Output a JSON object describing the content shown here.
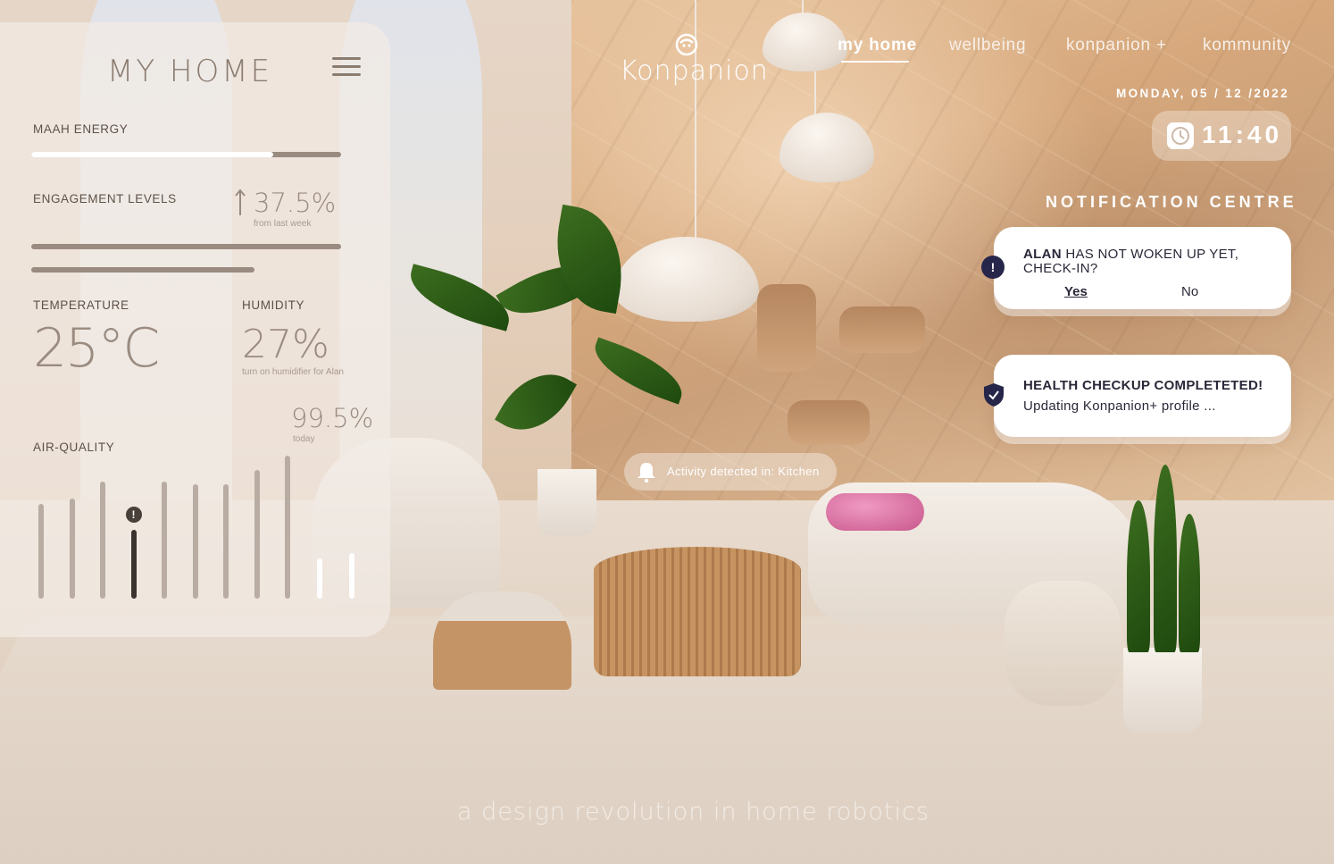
{
  "brand": {
    "name": "Konpanion"
  },
  "nav": {
    "items": [
      {
        "label": "my home",
        "active": true
      },
      {
        "label": "wellbeing",
        "active": false
      },
      {
        "label": "konpanion +",
        "active": false
      },
      {
        "label": "kommunity",
        "active": false
      }
    ]
  },
  "date": "MONDAY, 05 / 12 /2022",
  "clock": {
    "time": "11:40"
  },
  "panel": {
    "title": "MY HOME",
    "energy": {
      "label": "MAAH ENERGY",
      "level": 0.78
    },
    "engagement": {
      "label": "ENGAGEMENT LEVELS",
      "value": "37.5%",
      "note": "from last week",
      "bars": [
        1.0,
        0.72
      ]
    },
    "temperature": {
      "label": "TEMPERATURE",
      "value": "25°C"
    },
    "humidity": {
      "label": "HUMIDITY",
      "value": "27%",
      "note": "turn on humidifier for Alan"
    },
    "air_quality": {
      "label": "AIR-QUALITY",
      "value": "99.5%",
      "note": "today",
      "alert_index": 3,
      "bars": [
        0.66,
        0.7,
        0.82,
        0.48,
        0.82,
        0.8,
        0.8,
        0.9,
        1.0,
        0.28,
        0.32
      ]
    }
  },
  "notifications": {
    "title": "NOTIFICATION CENTRE",
    "items": [
      {
        "bold": "ALAN",
        "text": " HAS NOT WOKEN UP YET,",
        "text2": "CHECK-IN?",
        "yes": "Yes",
        "no": "No"
      },
      {
        "title": "HEALTH CHECKUP COMPLETETED!",
        "text": "Updating Konpanion+ profile ..."
      }
    ]
  },
  "activity": {
    "text": "Activity detected in: Kitchen"
  },
  "tagline": "a design revolution in home robotics"
}
